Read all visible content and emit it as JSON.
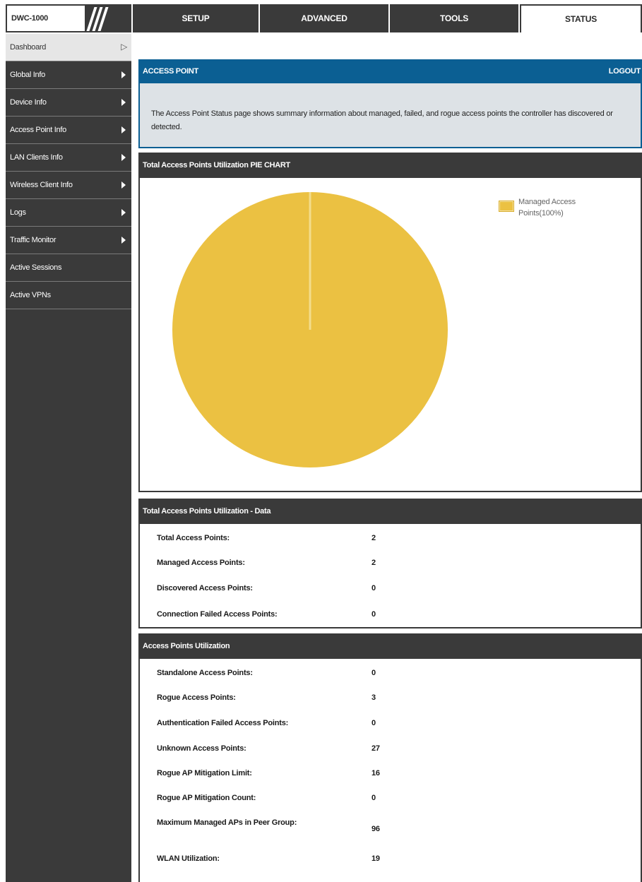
{
  "header": {
    "product": "DWC-1000",
    "tabs": [
      {
        "label": "SETUP"
      },
      {
        "label": "ADVANCED"
      },
      {
        "label": "TOOLS"
      },
      {
        "label": "STATUS"
      }
    ]
  },
  "sidebar": {
    "items": [
      {
        "label": "Dashboard"
      },
      {
        "label": "Global Info"
      },
      {
        "label": "Device Info"
      },
      {
        "label": "Access Point Info"
      },
      {
        "label": "LAN Clients Info"
      },
      {
        "label": "Wireless Client Info"
      },
      {
        "label": "Logs"
      },
      {
        "label": "Traffic Monitor"
      },
      {
        "label": "Active Sessions"
      },
      {
        "label": "Active VPNs"
      }
    ]
  },
  "page": {
    "title": "ACCESS POINT",
    "logout": "LOGOUT",
    "description": "The Access Point Status page shows summary information about managed, failed, and rogue access points the controller has discovered or detected."
  },
  "pie_section": {
    "title": "Total Access Points Utilization PIE CHART",
    "legend_label": "Managed Access Points(100%)",
    "slice_color": "#ebc142"
  },
  "chart_data": {
    "type": "pie",
    "categories": [
      "Managed Access Points"
    ],
    "values": [
      100
    ]
  },
  "data_section": {
    "title": "Total Access Points Utilization - Data",
    "rows": [
      {
        "label": "Total Access Points:",
        "value": "2"
      },
      {
        "label": "Managed Access Points:",
        "value": "2"
      },
      {
        "label": "Discovered Access Points:",
        "value": "0"
      },
      {
        "label": "Connection Failed Access Points:",
        "value": "0"
      }
    ]
  },
  "util_section": {
    "title": "Access Points Utilization",
    "rows": [
      {
        "label": "Standalone Access Points:",
        "value": "0"
      },
      {
        "label": "Rogue Access Points:",
        "value": "3"
      },
      {
        "label": "Authentication Failed Access Points:",
        "value": "0"
      },
      {
        "label": "Unknown Access Points:",
        "value": "27"
      },
      {
        "label": "Rogue AP Mitigation Limit:",
        "value": "16"
      },
      {
        "label": "Rogue AP Mitigation Count:",
        "value": "0"
      },
      {
        "label": "Maximum Managed APs in Peer Group:",
        "value": "96"
      },
      {
        "label": "WLAN Utilization:",
        "value": "19"
      }
    ]
  }
}
